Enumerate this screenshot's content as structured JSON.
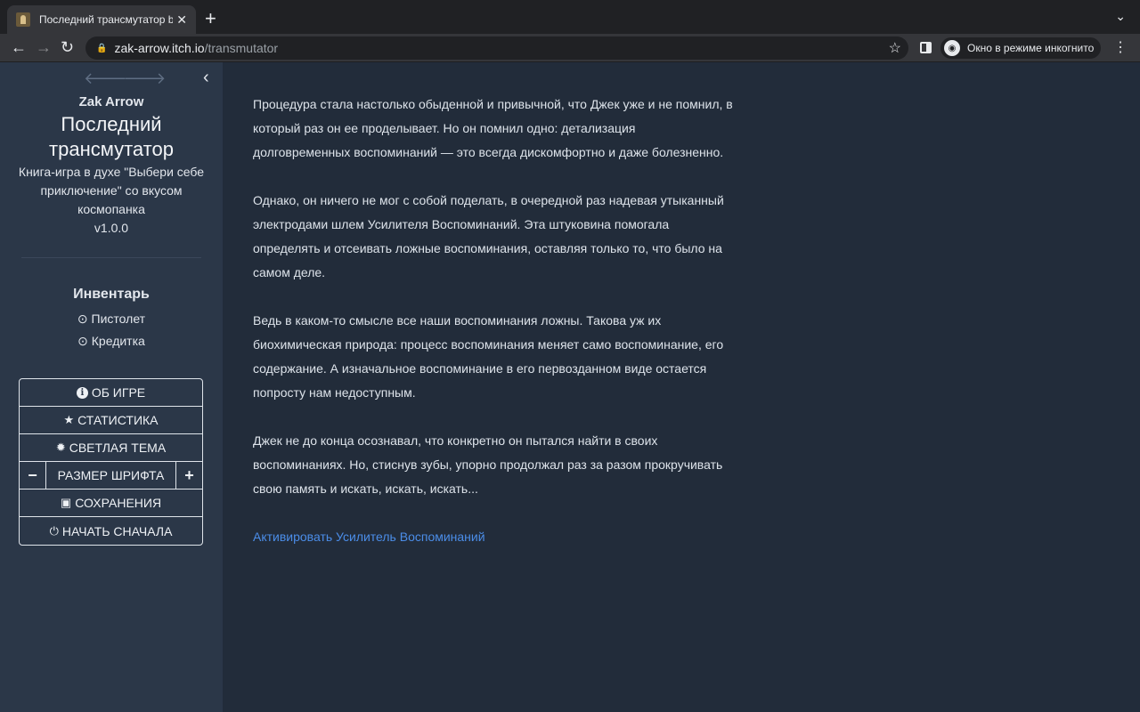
{
  "browser": {
    "tab_title": "Последний трансмутатор by",
    "tab_close": "✕",
    "new_tab": "+",
    "tab_menu": "⌄",
    "back": "←",
    "forward": "→",
    "reload": "↻",
    "url_host": "zak-arrow.itch.io",
    "url_path": "/transmutator",
    "bookmark": "☆",
    "incognito_label": "Окно в режиме инкогнито",
    "menu": "⋮"
  },
  "sidebar": {
    "nav_back": "🡐",
    "nav_forward": "🡒",
    "collapse": "‹",
    "author": "Zak Arrow",
    "title": "Последний трансмутатор",
    "description": "Книга-игра в духе \"Выбери себе приключение\" со вкусом космопанка",
    "version": "v1.0.0",
    "inventory_title": "Инвентарь",
    "inventory": [
      "⊙ Пистолет",
      "⊙ Кредитка"
    ],
    "menu": {
      "about": "ОБ ИГРЕ",
      "stats": "СТАТИСТИКА",
      "theme": "СВЕТЛАЯ ТЕМА",
      "font_minus": "−",
      "font_size": "РАЗМЕР ШРИФТА",
      "font_plus": "+",
      "saves": "СОХРАНЕНИЯ",
      "restart": "НАЧАТЬ СНАЧАЛА"
    }
  },
  "story": {
    "paragraphs": [
      "Процедура стала настолько обыденной и привычной, что Джек уже и не помнил, в который раз он ее проделывает. Но он помнил одно: детализация долговременных воспоминаний — это всегда дискомфортно и даже болезненно.",
      "Однако, он ничего не мог с собой поделать, в очередной раз надевая утыканный электродами шлем Усилителя Воспоминаний. Эта штуковина помогала определять и отсеивать ложные воспоминания, оставляя только то, что было на самом деле.",
      "Ведь в каком-то смысле все наши воспоминания ложны. Такова уж их биохимическая природа: процесс воспоминания меняет само воспоминание, его содержание. А изначальное воспоминание в его первозданном виде остается попросту нам недоступным.",
      "Джек не до конца осознавал, что конкретно он пытался найти в своих воспоминаниях. Но, стиснув зубы, упорно продолжал раз за разом прокручивать свою память и искать, искать, искать..."
    ],
    "choice": "Активировать Усилитель Воспоминаний"
  },
  "colors": {
    "page_bg": "#222c3a",
    "sidebar_bg": "#2b3748",
    "link": "#4b8de8",
    "text": "#dde3ea"
  }
}
